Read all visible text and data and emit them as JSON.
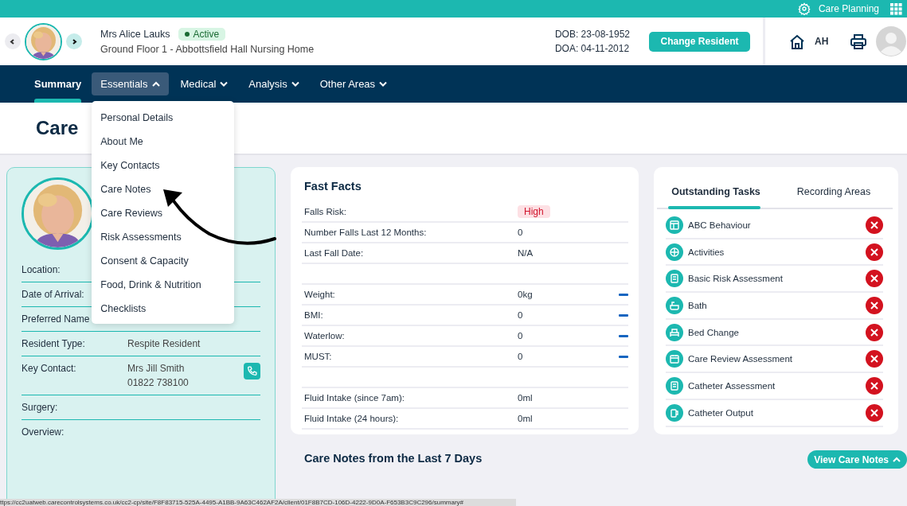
{
  "top_bar": {
    "app_name": "Care Planning"
  },
  "resident": {
    "name": "Mrs Alice Lauks",
    "status": "Active",
    "location": "Ground Floor 1 - Abbottsfield Hall Nursing Home",
    "dob": "DOB: 23-08-1952",
    "doa": "DOA: 04-11-2012"
  },
  "change_button": "Change Resident",
  "user_initials": "AH",
  "nav": [
    {
      "label": "Summary",
      "selected": true,
      "dropdown": false,
      "expanded": false
    },
    {
      "label": "Essentials",
      "selected": false,
      "dropdown": true,
      "expanded": true
    },
    {
      "label": "Medical",
      "selected": false,
      "dropdown": true,
      "expanded": false
    },
    {
      "label": "Analysis",
      "selected": false,
      "dropdown": true,
      "expanded": false
    },
    {
      "label": "Other Areas",
      "selected": false,
      "dropdown": true,
      "expanded": false
    }
  ],
  "essentials_menu": [
    "Personal Details",
    "About Me",
    "Key Contacts",
    "Care Notes",
    "Care Reviews",
    "Risk Assessments",
    "Consent & Capacity",
    "Food, Drink & Nutrition",
    "Checklists"
  ],
  "page_title": "Care",
  "profile": [
    {
      "label": "Location:"
    },
    {
      "label": "Date of Arrival:"
    },
    {
      "label": "Preferred Name"
    },
    {
      "label": "Resident Type:",
      "value": "Respite Resident"
    },
    {
      "label": "Key Contact:",
      "value": "Mrs Jill Smith",
      "value_2": "01822 738100",
      "kind": "contact"
    },
    {
      "label": "Surgery:"
    },
    {
      "label": "Overview:"
    }
  ],
  "fast_facts": {
    "title": "Fast Facts",
    "groups": [
      [
        {
          "label": "Falls Risk:",
          "value": "High",
          "kind": "badge"
        },
        {
          "label": "Number Falls Last 12 Months:",
          "value": "0",
          "kind": "text"
        },
        {
          "label": "Last Fall Date:",
          "value": "N/A",
          "kind": "text"
        }
      ],
      [
        {
          "label": "Weight:",
          "value": "0kg",
          "kind": "text",
          "trend": true
        },
        {
          "label": "BMI:",
          "value": "0",
          "kind": "text",
          "trend": true
        },
        {
          "label": "Waterlow:",
          "value": "0",
          "kind": "text",
          "trend": true
        },
        {
          "label": "MUST:",
          "value": "0",
          "kind": "text",
          "trend": true
        }
      ],
      [
        {
          "label": "Fluid Intake (since 7am):",
          "value": "0ml",
          "kind": "text"
        },
        {
          "label": "Fluid Intake (24 hours):",
          "value": "0ml",
          "kind": "text"
        }
      ]
    ]
  },
  "task_tabs": [
    {
      "label": "Outstanding Tasks",
      "selected": true
    },
    {
      "label": "Recording Areas",
      "selected": false
    }
  ],
  "tasks": [
    {
      "label": "ABC Behaviour",
      "done": false
    },
    {
      "label": "Activities",
      "done": false
    },
    {
      "label": "Basic Risk Assessment",
      "done": false
    },
    {
      "label": "Bath",
      "done": false
    },
    {
      "label": "Bed Change",
      "done": false
    },
    {
      "label": "Care Review Assessment",
      "done": false
    },
    {
      "label": "Catheter Assessment",
      "done": false
    },
    {
      "label": "Catheter Output",
      "done": false
    }
  ],
  "care_notes_heading": "Care Notes from the Last 7 Days",
  "view_notes_button": "View Care Notes",
  "status_bar": "ttps://cc2uatweb.carecontrolsystems.co.uk/cc2-cp/site/F8F83715-525A-4495-A1BB-9A63C462AF2A/client/01F8B7CD-106D-4222-9D0A-F653B3C9C296/summary#"
}
